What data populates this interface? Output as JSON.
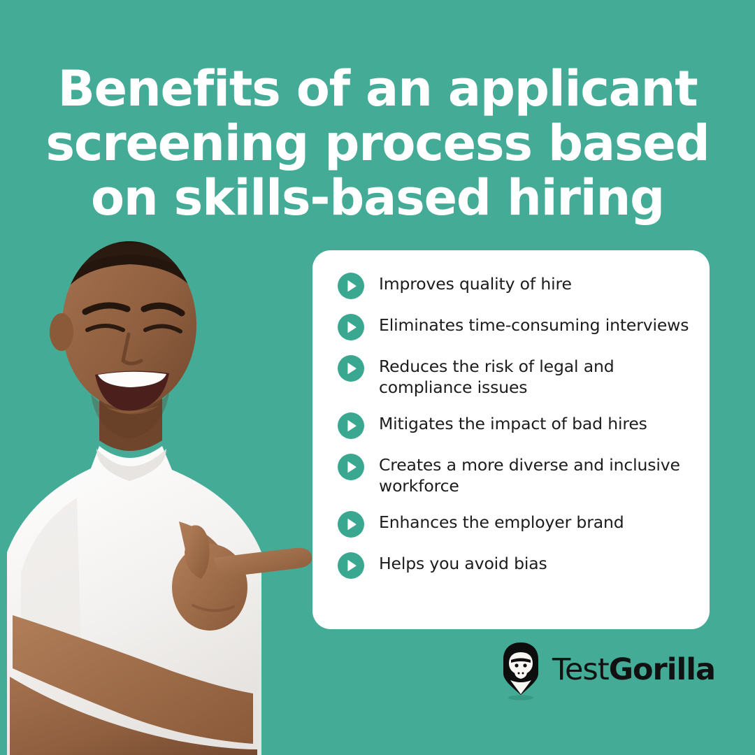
{
  "colors": {
    "background": "#44ab96",
    "card": "#ffffff",
    "bullet": "#3aa891",
    "title_text": "#ffffff",
    "body_text": "#1c1c1c",
    "logo_text": "#111111",
    "logo_mark": "#0d0d0d"
  },
  "header": {
    "title": "Benefits of an applicant\nscreening process based\non skills-based hiring"
  },
  "benefits_card": {
    "items": [
      {
        "icon": "play-circle-icon",
        "label": "Improves quality of hire"
      },
      {
        "icon": "play-circle-icon",
        "label": "Eliminates time-consuming interviews"
      },
      {
        "icon": "play-circle-icon",
        "label": "Reduces the risk of legal and compliance issues"
      },
      {
        "icon": "play-circle-icon",
        "label": "Mitigates the impact of bad hires"
      },
      {
        "icon": "play-circle-icon",
        "label": "Creates a more diverse and inclusive workforce"
      },
      {
        "icon": "play-circle-icon",
        "label": "Enhances the employer brand"
      },
      {
        "icon": "play-circle-icon",
        "label": "Helps you avoid bias"
      }
    ]
  },
  "photo": {
    "description": "Smiling man in white t-shirt with arms crossed pointing right"
  },
  "logo": {
    "mark": "gorilla-shield-icon",
    "name_light": "Test",
    "name_bold": "Gorilla"
  }
}
